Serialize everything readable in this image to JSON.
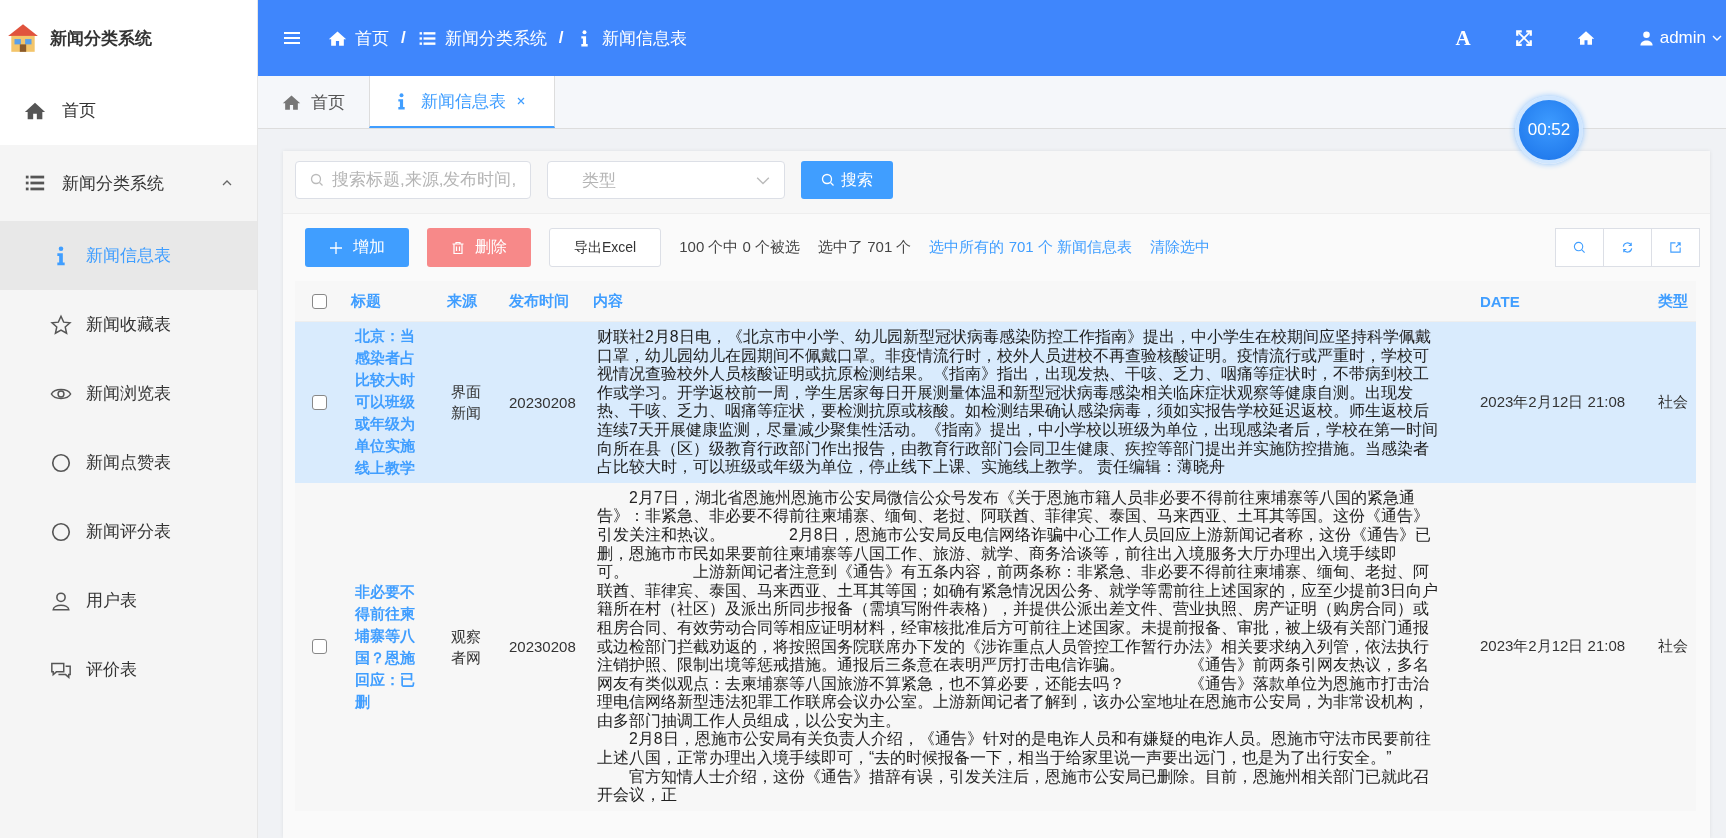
{
  "logo": {
    "title": "新闻分类系统"
  },
  "sidebar": {
    "items": [
      {
        "label": "首页",
        "selected": false
      },
      {
        "label": "新闻分类系统",
        "selected": false,
        "expanded": true,
        "children": [
          {
            "label": "新闻信息表",
            "selected": true
          },
          {
            "label": "新闻收藏表",
            "selected": false
          },
          {
            "label": "新闻浏览表",
            "selected": false
          },
          {
            "label": "新闻点赞表",
            "selected": false
          },
          {
            "label": "新闻评分表",
            "selected": false
          },
          {
            "label": "用户表",
            "selected": false
          },
          {
            "label": "评价表",
            "selected": false
          }
        ]
      }
    ]
  },
  "breadcrumb": [
    "首页",
    "新闻分类系统",
    "新闻信息表"
  ],
  "breadcrumb_separator": "/",
  "header": {
    "font_icon": "A",
    "user": "admin"
  },
  "tabs": [
    {
      "label": "首页",
      "selected": false,
      "closable": false
    },
    {
      "label": "新闻信息表",
      "selected": true,
      "closable": true
    }
  ],
  "timer": "00:52",
  "search": {
    "placeholder": "搜索标题,来源,发布时间,",
    "type_placeholder": "类型",
    "button": "搜索"
  },
  "toolbar": {
    "add": "增加",
    "delete": "删除",
    "export": "导出Excel",
    "count": "100 个中 0 个被选",
    "selected_count": "选中了 701 个",
    "select_all": "选中所有的 701 个 新闻信息表",
    "clear": "清除选中"
  },
  "table": {
    "all_checked": false,
    "columns": [
      "标题",
      "来源",
      "发布时间",
      "内容",
      "DATE",
      "类型"
    ],
    "rows": [
      {
        "checked": false,
        "highlighted": true,
        "title": "北京：当感染者占比较大时可以班级或年级为单位实施线上教学",
        "source": "界面新闻",
        "time": "20230208",
        "content": "财联社2月8日电，《北京市中小学、幼儿园新型冠状病毒感染防控工作指南》提出，中小学生在校期间应坚持科学佩戴口罩，幼儿园幼儿在园期间不佩戴口罩。非疫情流行时，校外人员进校不再查验核酸证明。疫情流行或严重时，学校可视情况查验校外人员核酸证明或抗原检测结果。《指南》指出，出现发热、干咳、乏力、咽痛等症状时，不带病到校工作或学习。开学返校前一周，学生居家每日开展测量体温和新型冠状病毒感染相关临床症状观察等健康自测。出现发热、干咳、乏力、咽痛等症状，要检测抗原或核酸。如检测结果确认感染病毒，须如实报告学校延迟返校。师生返校后连续7天开展健康监测，尽量减少聚集性活动。《指南》提出，中小学校以班级为单位，出现感染者后，学校在第一时间向所在县（区）级教育行政部门作出报告，由教育行政部门会同卫生健康、疾控等部门提出并实施防控措施。当感染者占比较大时，可以班级或年级为单位，停止线下上课、实施线上教学。 责任编辑：薄晓舟",
        "date": "2023年2月12日 21:08",
        "type": "社会"
      },
      {
        "checked": false,
        "highlighted": false,
        "title": "非必要不得前往柬埔寨等八国？恩施回应：已删",
        "source": "观察者网",
        "time": "20230208",
        "content": "　　2月7日，湖北省恩施州恩施市公安局微信公众号发布《关于恩施市籍人员非必要不得前往柬埔寨等八国的紧急通告》：非紧急、非必要不得前往柬埔寨、缅甸、老挝、阿联酋、菲律宾、泰国、马来西亚、土耳其等国。这份《通告》引发关注和热议。　　　　2月8日，恩施市公安局反电信网络诈骗中心工作人员回应上游新闻记者称，这份《通告》已删，恩施市市民如果要前往柬埔寨等八国工作、旅游、就学、商务洽谈等，前往出入境服务大厅办理出入境手续即可。　　　　上游新闻记者注意到《通告》有五条内容，前两条称：非紧急、非必要不得前往柬埔寨、缅甸、老挝、阿联酋、菲律宾、泰国、马来西亚、土耳其等国；如确有紧急情况因公务、就学等需前往上述国家的，应至少提前3日向户籍所在村（社区）及派出所同步报备（需填写附件表格），并提供公派出差文件、营业执照、房产证明（购房合同）或租房合同、有效劳动合同等相应证明材料，经审核批准后方可前往上述国家。未提前报备、审批，被上级有关部门通报或边检部门拦截劝返的，将按照国务院联席办下发的《涉诈重点人员管控工作暂行办法》相关要求纳入列管，依法执行注销护照、限制出境等惩戒措施。通报后三条意在表明严厉打击电信诈骗。　　　　《通告》前两条引网友热议，多名网友有类似观点：去柬埔寨等八国旅游不算紧急，也不算必要，还能去吗？　　　　《通告》落款单位为恩施市打击治理电信网络新型违法犯罪工作联席会议办公室。上游新闻记者了解到，该办公室地址在恩施市公安局，为非常设机构，由多部门抽调工作人员组成，以公安为主。\n　　2月8日，恩施市公安局有关负责人介绍，《通告》针对的是电诈人员和有嫌疑的电诈人员。恩施市守法市民要前往上述八国，正常办理出入境手续即可，“去的时候报备一下，相当于给家里说一声要出远门，也是为了出行安全。”　　　　官方知情人士介绍，这份《通告》措辞有误，引发关注后，恩施市公安局已删除。目前，恩施州相关部门已就此召开会议，正",
        "date": "2023年2月12日 21:08",
        "type": "社会"
      }
    ]
  }
}
